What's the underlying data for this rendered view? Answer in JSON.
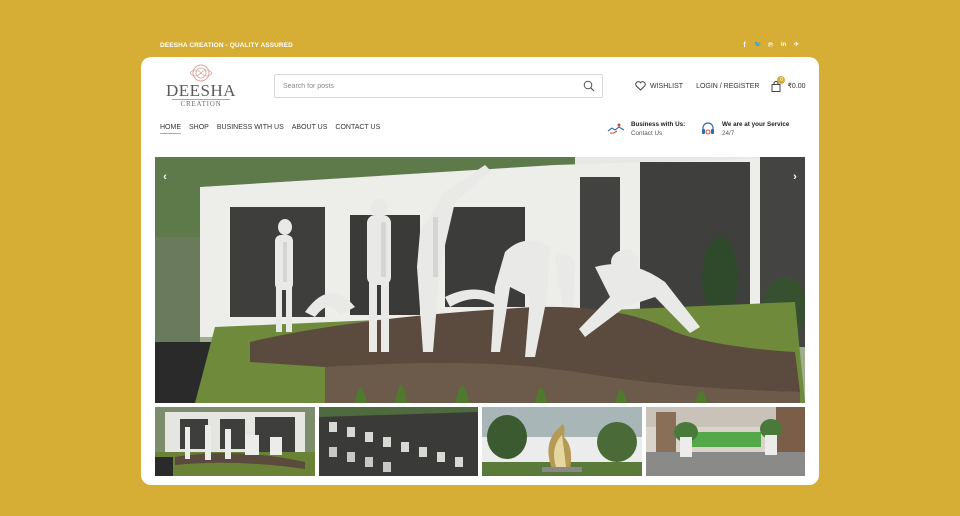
{
  "topbar": {
    "tagline": "DEESHA CREATION - QUALITY ASSURED",
    "social": [
      {
        "icon": "facebook-icon",
        "glyph": "f"
      },
      {
        "icon": "twitter-icon",
        "glyph": "🐦"
      },
      {
        "icon": "pinterest-icon",
        "glyph": "℗"
      },
      {
        "icon": "linkedin-icon",
        "glyph": "in"
      },
      {
        "icon": "telegram-icon",
        "glyph": "✈"
      }
    ]
  },
  "logo": {
    "name": "DEESHA",
    "sub": "CREATION"
  },
  "search": {
    "placeholder": "Search for posts"
  },
  "header": {
    "wishlist": "WISHLIST",
    "login": "LOGIN / REGISTER",
    "cart_count": "0",
    "cart_total": "₹0.00"
  },
  "nav": {
    "items": [
      "HOME",
      "SHOP",
      "BUSINESS WITH US",
      "ABOUT US",
      "CONTACT US"
    ],
    "active": "HOME"
  },
  "info": {
    "business_title": "Business with Us:",
    "business_sub": "Contact Us",
    "service_title": "We are at your Service",
    "service_sub": "24/7"
  },
  "slider": {
    "prev": "‹",
    "next": "›"
  },
  "colors": {
    "brand": "#d6ad35",
    "text": "#333333"
  }
}
